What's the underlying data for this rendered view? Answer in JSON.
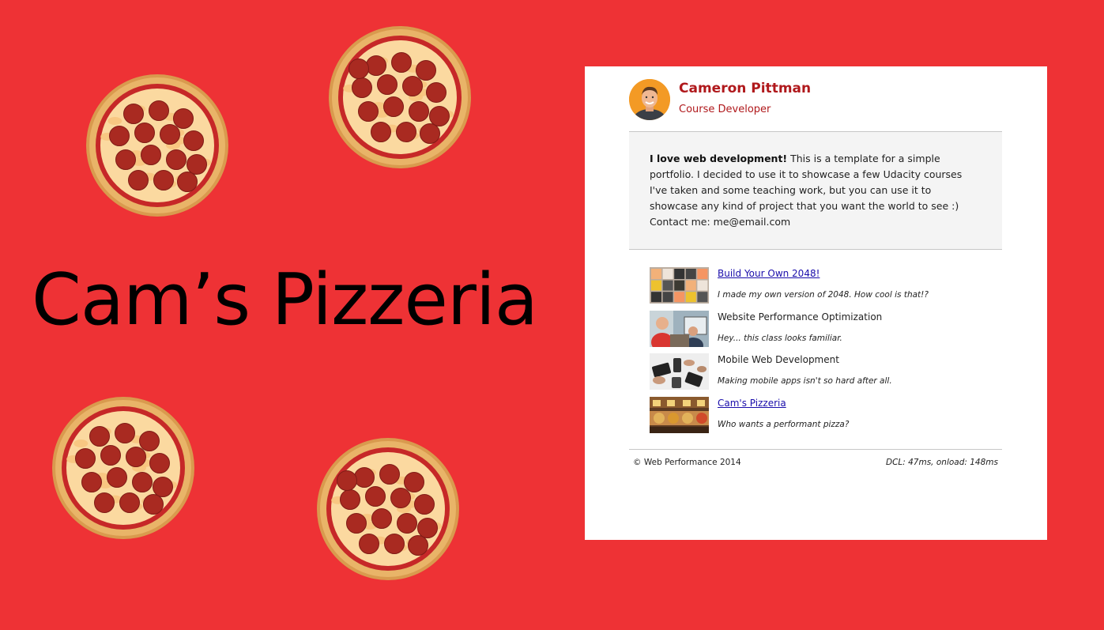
{
  "headline": "Cam’s Pizzeria",
  "profile": {
    "name": "Cameron Pittman",
    "role": "Course Developer"
  },
  "intro": {
    "bold": "I love web development!",
    "text": " This is a template for a simple portfolio. I decided to use it to showcase a few Udacity courses I've taken and some teaching work, but you can use it to showcase any kind of project that you want the world to see :)",
    "contact": "Contact me: me@email.com"
  },
  "projects": [
    {
      "title": "Build Your Own 2048!",
      "desc": "I made my own version of 2048. How cool is that!?",
      "link": true
    },
    {
      "title": "Website Performance Optimization",
      "desc": "Hey... this class looks familiar.",
      "link": false
    },
    {
      "title": "Mobile Web Development",
      "desc": "Making mobile apps isn't so hard after all.",
      "link": false
    },
    {
      "title": "Cam's Pizzeria",
      "desc": "Who wants a performant pizza?",
      "link": true
    }
  ],
  "footer": {
    "copyright": "© Web Performance 2014",
    "perf": "DCL: 47ms, onload: 148ms"
  },
  "colors": {
    "background": "#ee3235",
    "accent": "#b0191c",
    "link": "#1a0dab"
  },
  "icons": [
    "pizza-icon",
    "avatar-photo"
  ]
}
